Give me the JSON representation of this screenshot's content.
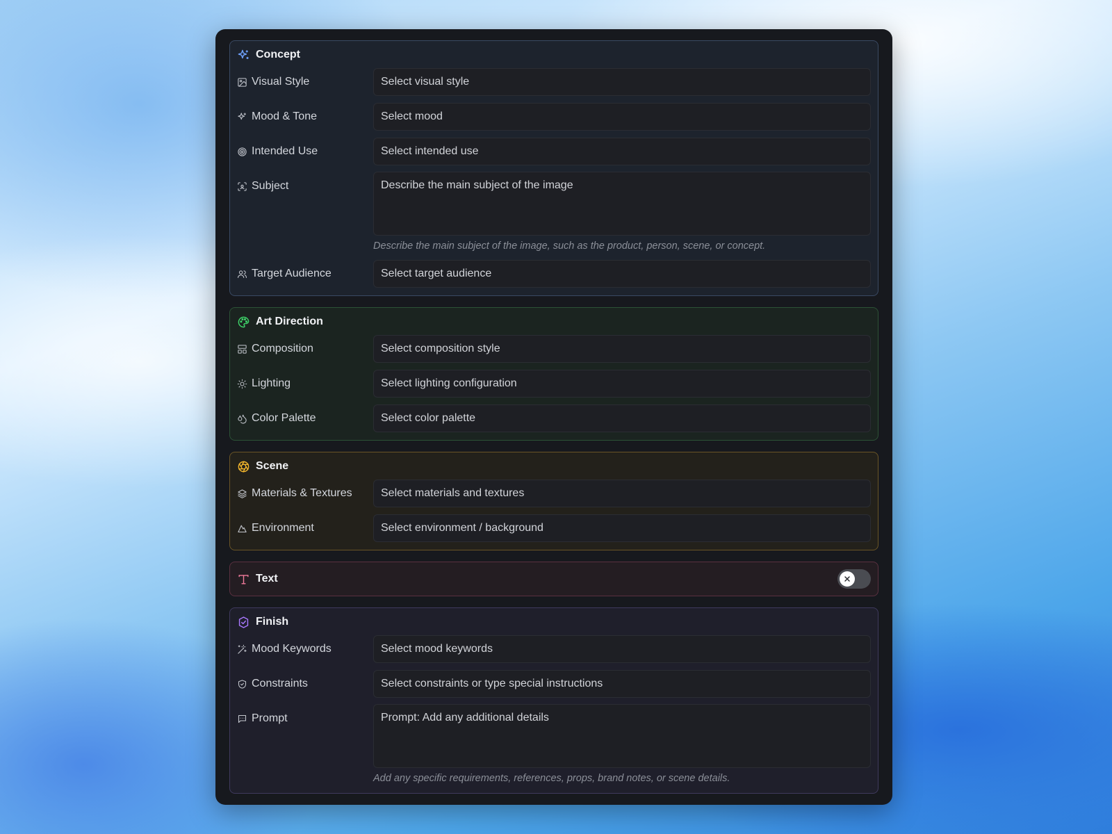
{
  "colors": {
    "concept_accent": "#6fa2ff",
    "art_accent": "#3fd46a",
    "scene_accent": "#f2b52c",
    "text_accent": "#f07a9a",
    "finish_accent": "#a978ff"
  },
  "concept": {
    "title": "Concept",
    "visual_style": {
      "label": "Visual Style",
      "value": "Select visual style"
    },
    "mood_tone": {
      "label": "Mood & Tone",
      "value": "Select mood"
    },
    "intended_use": {
      "label": "Intended Use",
      "value": "Select intended use"
    },
    "subject": {
      "label": "Subject",
      "placeholder": "Describe the main subject of the image",
      "hint": "Describe the main subject of the image, such as the product, person, scene, or concept."
    },
    "target_audience": {
      "label": "Target Audience",
      "value": "Select target audience"
    }
  },
  "art_direction": {
    "title": "Art Direction",
    "composition": {
      "label": "Composition",
      "value": "Select composition style"
    },
    "lighting": {
      "label": "Lighting",
      "value": "Select lighting configuration"
    },
    "color_palette": {
      "label": "Color Palette",
      "value": "Select color palette"
    }
  },
  "scene": {
    "title": "Scene",
    "materials": {
      "label": "Materials & Textures",
      "value": "Select materials and textures"
    },
    "environment": {
      "label": "Environment",
      "value": "Select environment / background"
    }
  },
  "text_section": {
    "title": "Text",
    "toggle_state": "off"
  },
  "finish": {
    "title": "Finish",
    "mood_keywords": {
      "label": "Mood Keywords",
      "value": "Select mood keywords"
    },
    "constraints": {
      "label": "Constraints",
      "value": "Select constraints or type special instructions"
    },
    "prompt": {
      "label": "Prompt",
      "placeholder": "Prompt: Add any additional details",
      "hint": "Add any specific requirements, references, props, brand notes, or scene details."
    }
  }
}
